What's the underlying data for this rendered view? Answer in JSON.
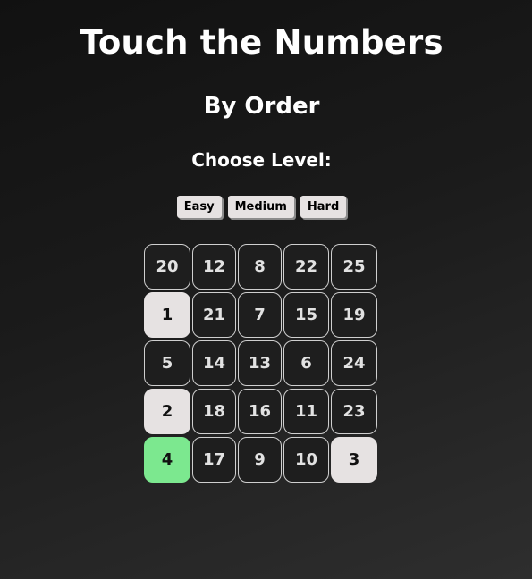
{
  "header": {
    "title": "Touch the Numbers",
    "subtitle": "By Order",
    "choose_level": "Choose Level:"
  },
  "levels": [
    "Easy",
    "Medium",
    "Hard"
  ],
  "grid": {
    "cells": [
      {
        "value": "20",
        "state": "normal"
      },
      {
        "value": "12",
        "state": "normal"
      },
      {
        "value": "8",
        "state": "normal"
      },
      {
        "value": "22",
        "state": "normal"
      },
      {
        "value": "25",
        "state": "normal"
      },
      {
        "value": "1",
        "state": "found"
      },
      {
        "value": "21",
        "state": "normal"
      },
      {
        "value": "7",
        "state": "normal"
      },
      {
        "value": "15",
        "state": "normal"
      },
      {
        "value": "19",
        "state": "normal"
      },
      {
        "value": "5",
        "state": "normal"
      },
      {
        "value": "14",
        "state": "normal"
      },
      {
        "value": "13",
        "state": "normal"
      },
      {
        "value": "6",
        "state": "normal"
      },
      {
        "value": "24",
        "state": "normal"
      },
      {
        "value": "2",
        "state": "found"
      },
      {
        "value": "18",
        "state": "normal"
      },
      {
        "value": "16",
        "state": "normal"
      },
      {
        "value": "11",
        "state": "normal"
      },
      {
        "value": "23",
        "state": "normal"
      },
      {
        "value": "4",
        "state": "current"
      },
      {
        "value": "17",
        "state": "normal"
      },
      {
        "value": "9",
        "state": "normal"
      },
      {
        "value": "10",
        "state": "normal"
      },
      {
        "value": "3",
        "state": "found"
      }
    ]
  },
  "colors": {
    "found": "#e6e2e2",
    "current": "#7ce88f",
    "cell_border": "#cfcfcf",
    "background": "#1b1b1b"
  }
}
